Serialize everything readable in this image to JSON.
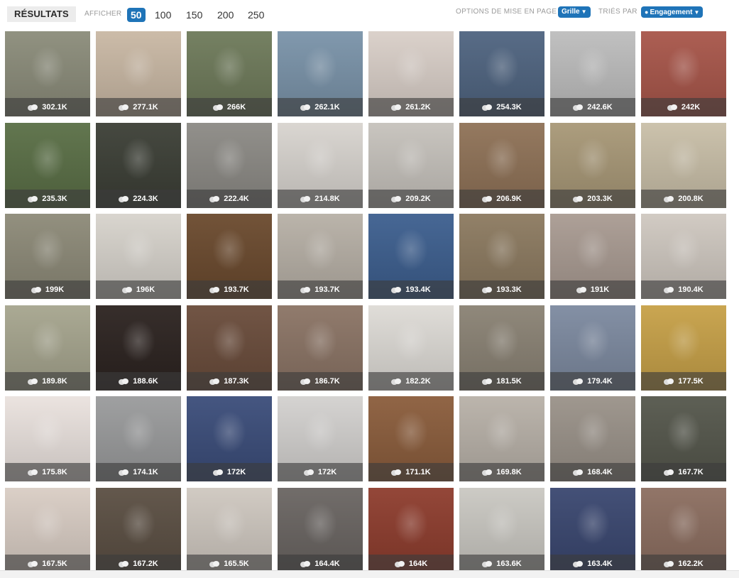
{
  "header": {
    "results_tab": "RÉSULTATS",
    "show_label": "AFFICHER",
    "counts": [
      "50",
      "100",
      "150",
      "200",
      "250"
    ],
    "active_count": "50",
    "layout_label": "OPTIONS DE MISE EN PAGE",
    "layout_value": "Grille",
    "sort_label": "TRIÉS PAR",
    "sort_value": "Engagement",
    "accent": "#1f74b8"
  },
  "grid": {
    "rows": [
      [
        "302.1K",
        "277.1K",
        "266K",
        "262.1K",
        "261.2K",
        "254.3K",
        "242.6K",
        "242K"
      ],
      [
        "235.3K",
        "224.3K",
        "222.4K",
        "214.8K",
        "209.2K",
        "206.9K",
        "203.3K",
        "200.8K"
      ],
      [
        "199K",
        "196K",
        "193.7K",
        "193.7K",
        "193.4K",
        "193.3K",
        "191K",
        "190.4K"
      ],
      [
        "189.8K",
        "188.6K",
        "187.3K",
        "186.7K",
        "182.2K",
        "181.5K",
        "179.4K",
        "177.5K"
      ],
      [
        "175.8K",
        "174.1K",
        "172K",
        "172K",
        "171.1K",
        "169.8K",
        "168.4K",
        "167.7K"
      ],
      [
        "167.5K",
        "167.2K",
        "165.5K",
        "164.4K",
        "164K",
        "163.6K",
        "163.4K",
        "162.2K"
      ]
    ],
    "colors": [
      [
        "#8b8c7a",
        "#c9b8a4",
        "#6e7a5a",
        "#7a93a9",
        "#d9cfc8",
        "#4f6480",
        "#bdbdbd",
        "#a8564a"
      ],
      [
        "#5a6f46",
        "#3c3f36",
        "#8c8a85",
        "#d8d4cf",
        "#c6c2bc",
        "#8f7257",
        "#a89877",
        "#c9bfa8"
      ],
      [
        "#8d8a78",
        "#d7d3cc",
        "#6b4a2e",
        "#b7b0a6",
        "#3d5f8f",
        "#8c7a60",
        "#a99b92",
        "#cfc8c0"
      ],
      [
        "#a6a58e",
        "#2c2320",
        "#6a4c3b",
        "#8b7465",
        "#dedbd6",
        "#8a8274",
        "#7d8aa0",
        "#c7a148"
      ],
      [
        "#eae2de",
        "#9a9b9c",
        "#3b4d7a",
        "#d3d1cf",
        "#8b5d3c",
        "#b8b1a8",
        "#9a9289",
        "#55574c"
      ],
      [
        "#d9cdc4",
        "#5b4f43",
        "#cfc8c0",
        "#6a6562",
        "#8e3d2e",
        "#cac8c2",
        "#3a4770",
        "#8c6e60"
      ]
    ]
  }
}
